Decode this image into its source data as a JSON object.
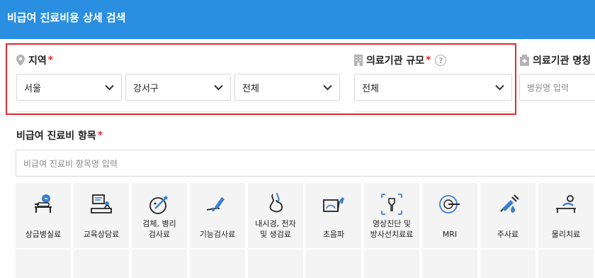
{
  "page_title": "비급여 진료비용 상세 검색",
  "region": {
    "label": "지역",
    "required_mark": "*",
    "city": "서울",
    "district": "강서구",
    "dong": "전체"
  },
  "scale": {
    "label": "의료기관 규모",
    "required_mark": "*",
    "help": "?",
    "value": "전체"
  },
  "name": {
    "label": "의료기관 명칭",
    "placeholder": "병원명 입력"
  },
  "item": {
    "label": "비급여 진료비 항목",
    "required_mark": "*",
    "placeholder": "비급여 진료비 항목명 입력"
  },
  "categories": [
    {
      "label": "상급병실료",
      "icon": "hospital-bed-icon"
    },
    {
      "label": "교육상담료",
      "icon": "consultation-icon"
    },
    {
      "label": "검체, 병리\n검사료",
      "icon": "specimen-icon"
    },
    {
      "label": "기능검사료",
      "icon": "function-test-icon"
    },
    {
      "label": "내시경, 천자\n및 생검료",
      "icon": "endoscope-icon"
    },
    {
      "label": "초음파",
      "icon": "ultrasound-icon"
    },
    {
      "label": "영상진단 및\n방사선치료료",
      "icon": "radiology-icon"
    },
    {
      "label": "MRI",
      "icon": "mri-icon"
    },
    {
      "label": "주사료",
      "icon": "injection-icon"
    },
    {
      "label": "물리치료",
      "icon": "physical-therapy-icon"
    }
  ],
  "colors": {
    "header_bg": "#2a8fe0",
    "highlight_border": "#e02a31",
    "required": "#e02a31",
    "icon_blue": "#3a7fd0"
  }
}
